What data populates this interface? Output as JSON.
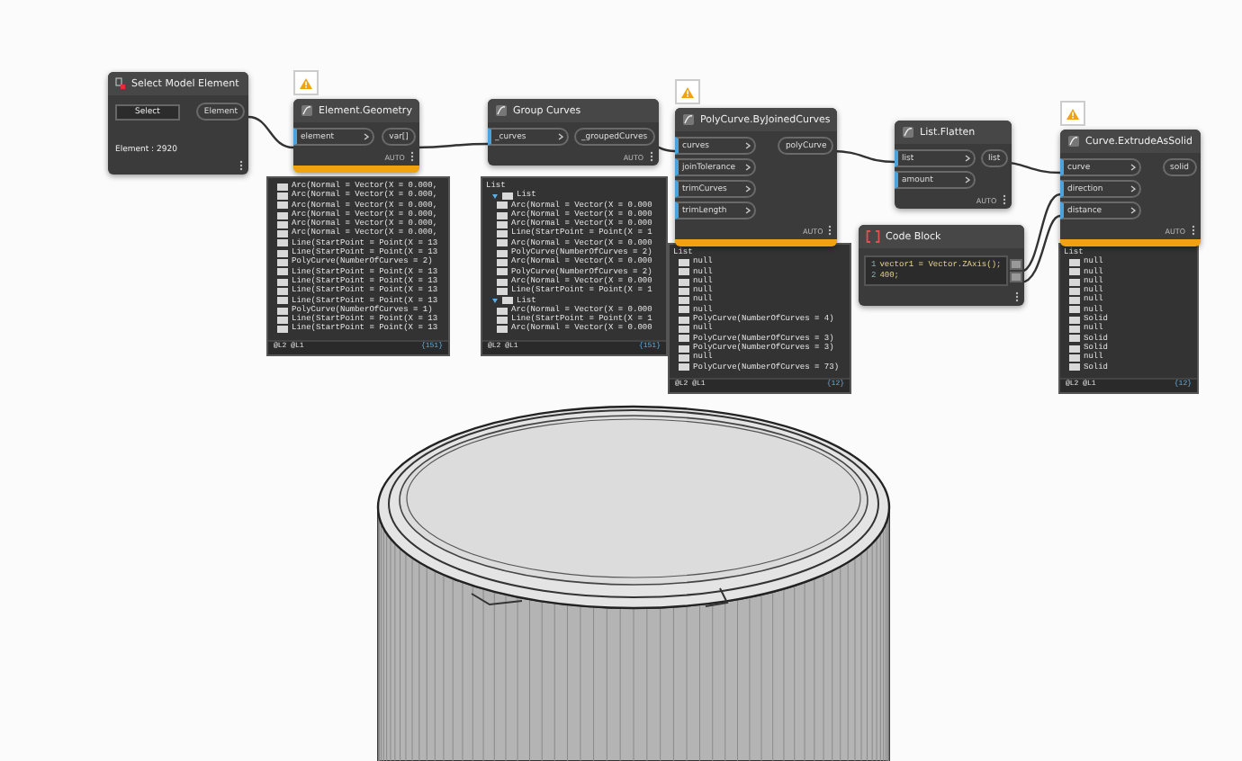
{
  "canvas": {
    "nodes": [
      {
        "kind": "select",
        "title": "Select Model Element",
        "warning": false,
        "button": "Select",
        "outputs": [
          "Element"
        ],
        "info": "Element : 2920"
      },
      {
        "kind": "function",
        "title": "Element.Geometry",
        "warning": true,
        "inputs": [
          "element"
        ],
        "outputs": [
          "var[]"
        ],
        "lacing": "AUTO",
        "preview": {
          "rows": [
            {
              "text": "Arc(Normal = Vector(X = 0.000,"
            },
            {
              "text": "Arc(Normal = Vector(X = 0.000,"
            },
            {
              "text": "Arc(Normal = Vector(X = 0.000,"
            },
            {
              "text": "Arc(Normal = Vector(X = 0.000,"
            },
            {
              "text": "Arc(Normal = Vector(X = 0.000,"
            },
            {
              "text": "Arc(Normal = Vector(X = 0.000,"
            },
            {
              "text": "Line(StartPoint = Point(X = 13"
            },
            {
              "text": "Line(StartPoint = Point(X = 13"
            },
            {
              "text": "PolyCurve(NumberOfCurves = 2)"
            },
            {
              "text": "Line(StartPoint = Point(X = 13"
            },
            {
              "text": "Line(StartPoint = Point(X = 13"
            },
            {
              "text": "Line(StartPoint = Point(X = 13"
            },
            {
              "text": "Line(StartPoint = Point(X = 13"
            },
            {
              "text": "PolyCurve(NumberOfCurves = 1)"
            },
            {
              "text": "Line(StartPoint = Point(X = 13"
            },
            {
              "text": "Line(StartPoint = Point(X = 13"
            }
          ],
          "levels": "@L2 @L1",
          "count": "{151}"
        }
      },
      {
        "kind": "function",
        "title": "Group Curves",
        "warning": false,
        "inputs": [
          "_curves"
        ],
        "outputs": [
          "_groupedCurves"
        ],
        "lacing": "AUTO",
        "preview": {
          "header": "List",
          "rows": [
            {
              "text": "List",
              "children": [
                {
                  "text": "Arc(Normal = Vector(X = 0.000"
                },
                {
                  "text": "Arc(Normal = Vector(X = 0.000"
                },
                {
                  "text": "Arc(Normal = Vector(X = 0.000"
                },
                {
                  "text": "Line(StartPoint = Point(X = 1"
                },
                {
                  "text": "Arc(Normal = Vector(X = 0.000"
                },
                {
                  "text": "PolyCurve(NumberOfCurves = 2)"
                },
                {
                  "text": "Arc(Normal = Vector(X = 0.000"
                },
                {
                  "text": "PolyCurve(NumberOfCurves = 2)"
                },
                {
                  "text": "Arc(Normal = Vector(X = 0.000"
                },
                {
                  "text": "Line(StartPoint = Point(X = 1"
                }
              ]
            },
            {
              "text": "List",
              "children": [
                {
                  "text": "Arc(Normal = Vector(X = 0.000"
                },
                {
                  "text": "Line(StartPoint = Point(X = 1"
                },
                {
                  "text": "Arc(Normal = Vector(X = 0.000"
                }
              ]
            }
          ],
          "levels": "@L2 @L1",
          "count": "{151}"
        }
      },
      {
        "kind": "function",
        "title": "PolyCurve.ByJoinedCurves",
        "warning": true,
        "inputs": [
          "curves",
          "joinTolerance",
          "trimCurves",
          "trimLength"
        ],
        "outputs": [
          "polyCurve"
        ],
        "lacing": "AUTO",
        "preview": {
          "header": "List",
          "rows": [
            {
              "text": "null"
            },
            {
              "text": "null"
            },
            {
              "text": "null"
            },
            {
              "text": "null"
            },
            {
              "text": "null"
            },
            {
              "text": "null"
            },
            {
              "text": "PolyCurve(NumberOfCurves = 4)"
            },
            {
              "text": "null"
            },
            {
              "text": "PolyCurve(NumberOfCurves = 3)"
            },
            {
              "text": "PolyCurve(NumberOfCurves = 3)"
            },
            {
              "text": "null"
            },
            {
              "text": "PolyCurve(NumberOfCurves = 73)"
            }
          ],
          "levels": "@L2 @L1",
          "count": "{12}"
        }
      },
      {
        "kind": "function",
        "title": "List.Flatten",
        "warning": false,
        "inputs": [
          "list",
          "amount"
        ],
        "outputs": [
          "list"
        ],
        "lacing": "AUTO"
      },
      {
        "kind": "code",
        "title": "Code Block",
        "warning": false,
        "lines": [
          {
            "number": "1",
            "text": "vector1 = Vector.ZAxis();"
          },
          {
            "number": "2",
            "text": "400;"
          }
        ]
      },
      {
        "kind": "function",
        "title": "Curve.ExtrudeAsSolid",
        "warning": true,
        "inputs": [
          "curve",
          "direction",
          "distance"
        ],
        "outputs": [
          "solid"
        ],
        "lacing": "AUTO",
        "preview": {
          "header": "List",
          "rows": [
            {
              "text": "null"
            },
            {
              "text": "null"
            },
            {
              "text": "null"
            },
            {
              "text": "null"
            },
            {
              "text": "null"
            },
            {
              "text": "null"
            },
            {
              "text": "Solid"
            },
            {
              "text": "null"
            },
            {
              "text": "Solid"
            },
            {
              "text": "Solid"
            },
            {
              "text": "null"
            },
            {
              "text": "Solid"
            }
          ],
          "levels": "@L2 @L1",
          "count": "{12}"
        }
      }
    ]
  }
}
